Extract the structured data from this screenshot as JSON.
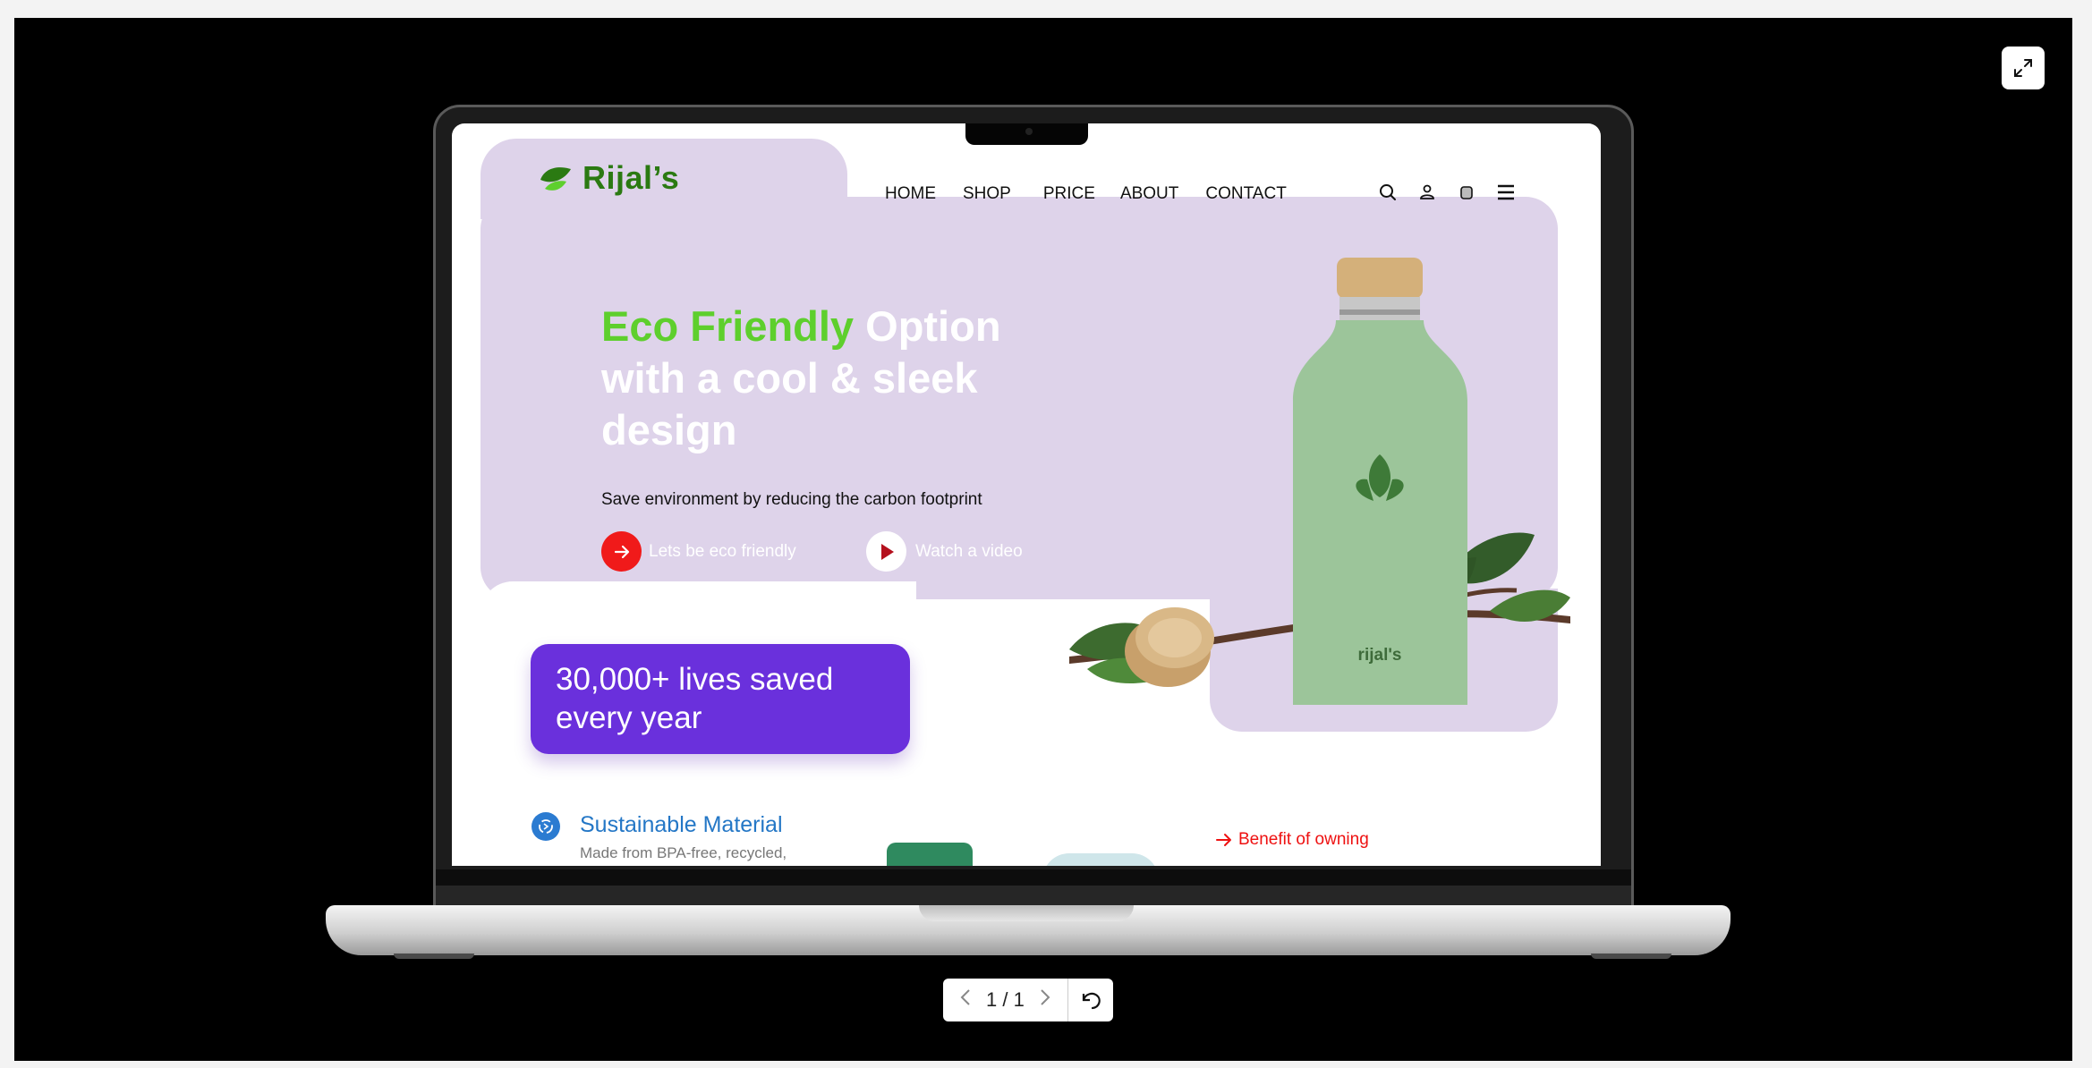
{
  "viewer": {
    "expand_icon": "expand-icon",
    "pager": {
      "current": "1",
      "separator": "/",
      "total": "1"
    },
    "undo_icon": "undo-icon"
  },
  "site": {
    "logo_text": "Rijal’s",
    "nav": [
      "HOME",
      "SHOP",
      "PRICE",
      "ABOUT",
      "CONTACT"
    ],
    "icons": [
      "search-icon",
      "user-icon",
      "cart-icon",
      "menu-icon"
    ],
    "hero": {
      "headline_green": "Eco Friendly",
      "headline_rest": " Option with a cool & sleek design",
      "subtext": "Save environment by reducing the carbon footprint",
      "cta_primary": "Lets be eco friendly",
      "cta_video": "Watch a video",
      "bottle_brand": "rijal's"
    },
    "stat": "30,000+ lives saved every year",
    "feature": {
      "title": "Sustainable Material",
      "description": "Made from BPA-free, recycled,"
    },
    "benefit_link": "Benefit of owning"
  },
  "colors": {
    "brand_green": "#2b7a12",
    "accent_green": "#5ecf2d",
    "hero_lavender": "#ded3ea",
    "stat_purple": "#6a30dc",
    "cta_red": "#f01a1a",
    "feature_blue": "#2477c6"
  }
}
